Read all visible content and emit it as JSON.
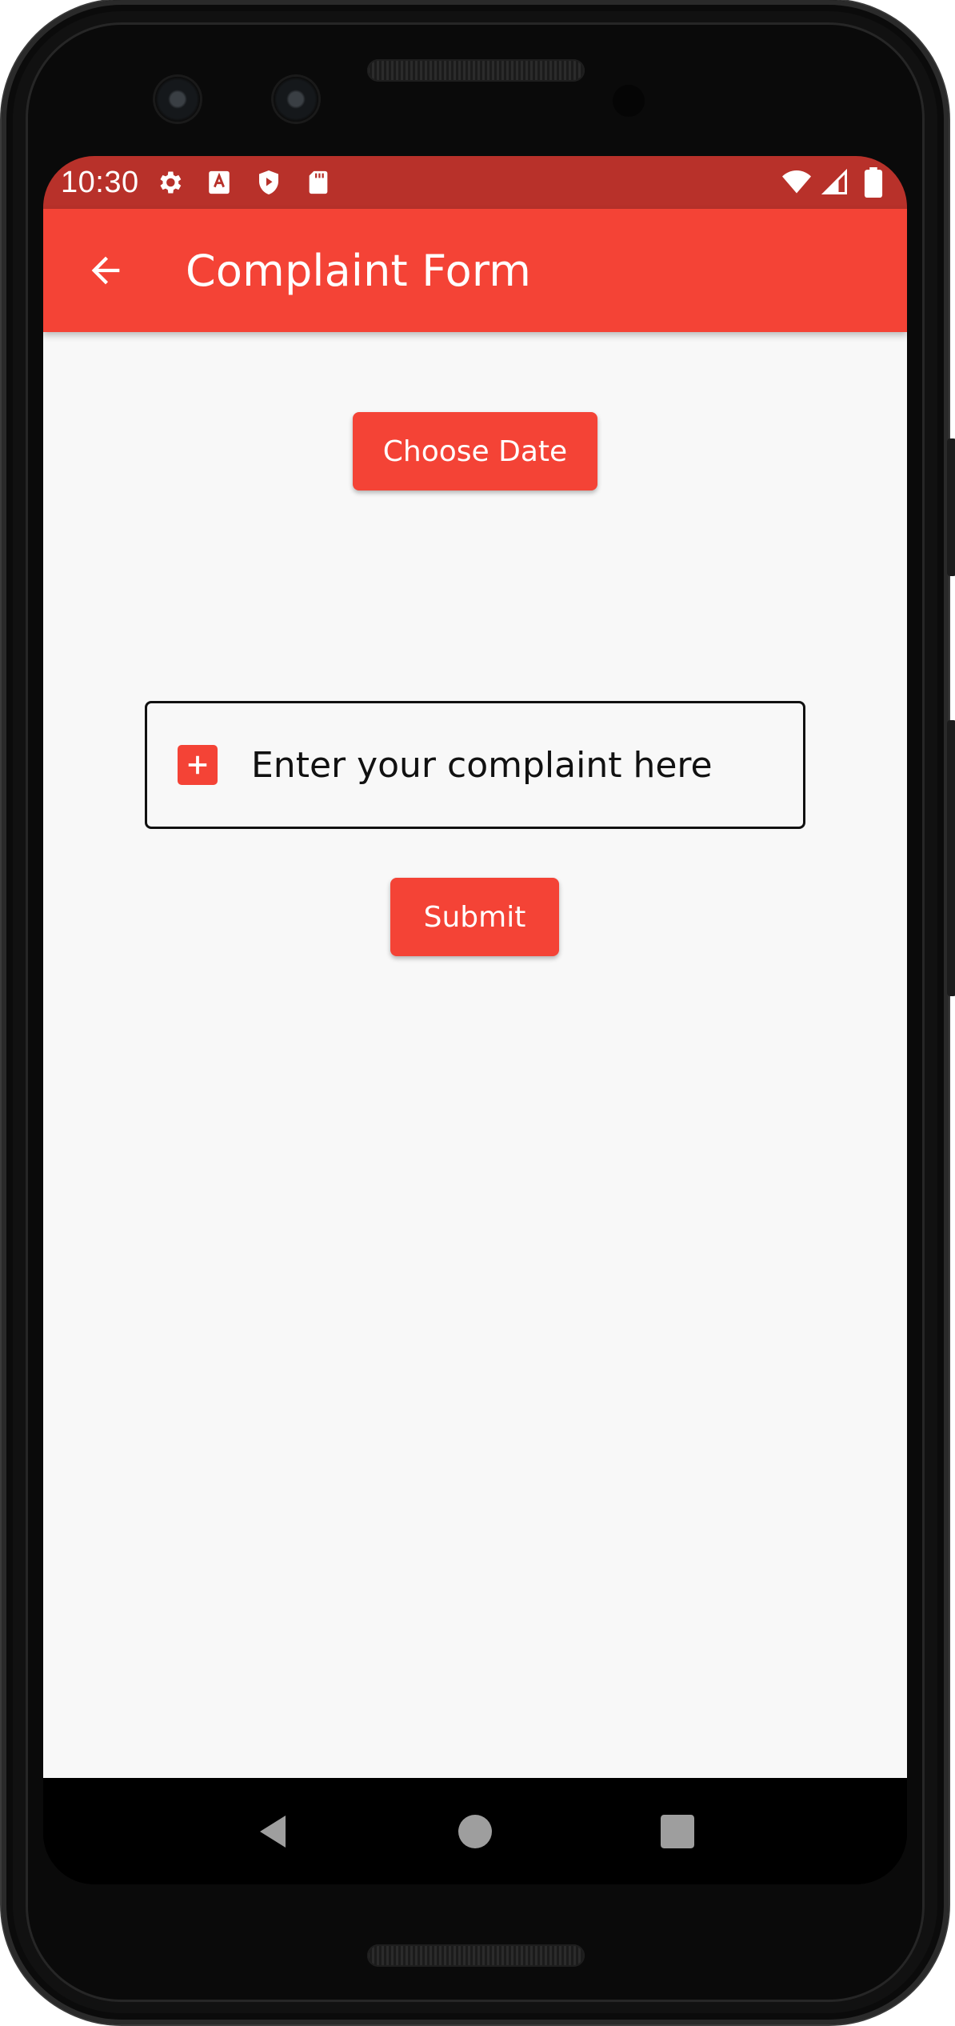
{
  "status_bar": {
    "time": "10:30",
    "left_icons": [
      "settings-icon",
      "translate-icon",
      "shield-play-icon",
      "sd-card-icon"
    ],
    "right_icons": [
      "wifi-icon",
      "signal-icon",
      "battery-icon"
    ],
    "color": "#b8312a"
  },
  "app_bar": {
    "title": "Complaint Form",
    "back_icon": "arrow-back-icon",
    "color": "#f44336"
  },
  "form": {
    "choose_date_label": "Choose Date",
    "complaint_placeholder": "Enter your complaint here",
    "complaint_icon": "plus-box-icon",
    "submit_label": "Submit",
    "accent": "#f44336"
  },
  "nav_bar": {
    "buttons": [
      "back-triangle-icon",
      "home-circle-icon",
      "recents-square-icon"
    ]
  }
}
